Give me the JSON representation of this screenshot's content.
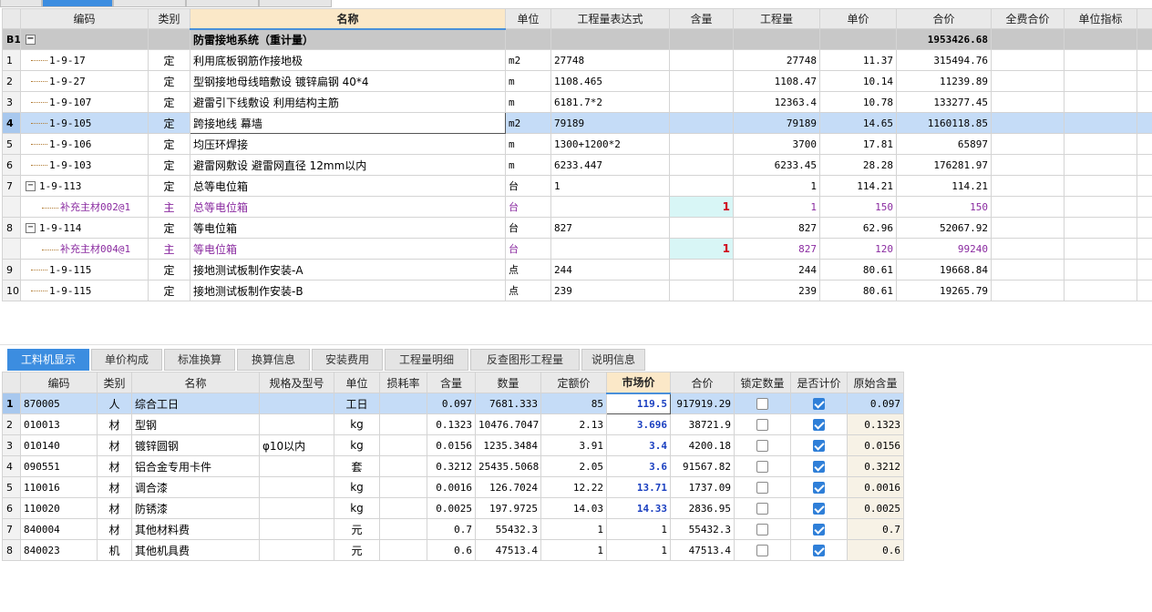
{
  "top_tabs": [
    "",
    "",
    "",
    ""
  ],
  "top_grid": {
    "headers": [
      "",
      "编码",
      "类别",
      "名称",
      "单位",
      "工程量表达式",
      "含量",
      "工程量",
      "单价",
      "合价",
      "全费合价",
      "单位指标"
    ],
    "section": {
      "rn": "B1",
      "expander": "−",
      "name": "防雷接地系统（重计量）",
      "total": "1953426.68"
    },
    "rows": [
      {
        "rn": "1",
        "code": "1-9-17",
        "cat": "定",
        "name": "利用底板钢筋作接地极",
        "unit": "m2",
        "expr": "27748",
        "content": "",
        "qty": "27748",
        "price": "11.37",
        "total": "315494.76",
        "kind": "normal"
      },
      {
        "rn": "2",
        "code": "1-9-27",
        "cat": "定",
        "name": "型钢接地母线暗敷设 镀锌扁钢 40*4",
        "unit": "m",
        "expr": "1108.465",
        "content": "",
        "qty": "1108.47",
        "price": "10.14",
        "total": "11239.89",
        "kind": "normal"
      },
      {
        "rn": "3",
        "code": "1-9-107",
        "cat": "定",
        "name": "避雷引下线敷设 利用结构主筋",
        "unit": "m",
        "expr": "6181.7*2",
        "content": "",
        "qty": "12363.4",
        "price": "10.78",
        "total": "133277.45",
        "kind": "normal"
      },
      {
        "rn": "4",
        "code": "1-9-105",
        "cat": "定",
        "name": "跨接地线 幕墙",
        "unit": "m2",
        "expr": "79189",
        "content": "",
        "qty": "79189",
        "price": "14.65",
        "total": "1160118.85",
        "kind": "selected"
      },
      {
        "rn": "5",
        "code": "1-9-106",
        "cat": "定",
        "name": "均压环焊接",
        "unit": "m",
        "expr": "1300+1200*2",
        "content": "",
        "qty": "3700",
        "price": "17.81",
        "total": "65897",
        "kind": "normal"
      },
      {
        "rn": "6",
        "code": "1-9-103",
        "cat": "定",
        "name": "避雷网敷设 避雷网直径 12mm以内",
        "unit": "m",
        "expr": "6233.447",
        "content": "",
        "qty": "6233.45",
        "price": "28.28",
        "total": "176281.97",
        "kind": "normal"
      },
      {
        "rn": "7",
        "code": "1-9-113",
        "cat": "定",
        "name": "总等电位箱",
        "unit": "台",
        "expr": "1",
        "content": "",
        "qty": "1",
        "price": "114.21",
        "total": "114.21",
        "kind": "parent",
        "expander": "−"
      },
      {
        "rn": "",
        "code": "补充主材002@1",
        "cat": "主",
        "name": "总等电位箱",
        "unit": "台",
        "expr": "",
        "content": "1",
        "qty": "1",
        "price": "150",
        "total": "150",
        "kind": "sub"
      },
      {
        "rn": "8",
        "code": "1-9-114",
        "cat": "定",
        "name": "等电位箱",
        "unit": "台",
        "expr": "827",
        "content": "",
        "qty": "827",
        "price": "62.96",
        "total": "52067.92",
        "kind": "parent",
        "expander": "−"
      },
      {
        "rn": "",
        "code": "补充主材004@1",
        "cat": "主",
        "name": "等电位箱",
        "unit": "台",
        "expr": "",
        "content": "1",
        "qty": "827",
        "price": "120",
        "total": "99240",
        "kind": "sub"
      },
      {
        "rn": "9",
        "code": "1-9-115",
        "cat": "定",
        "name": "接地测试板制作安装-A",
        "unit": "点",
        "expr": "244",
        "content": "",
        "qty": "244",
        "price": "80.61",
        "total": "19668.84",
        "kind": "normal"
      },
      {
        "rn": "10",
        "code": "1-9-115",
        "cat": "定",
        "name": "接地测试板制作安装-B",
        "unit": "点",
        "expr": "239",
        "content": "",
        "qty": "239",
        "price": "80.61",
        "total": "19265.79",
        "kind": "normal"
      }
    ]
  },
  "bottom_tabs": [
    "工料机显示",
    "单价构成",
    "标准换算",
    "换算信息",
    "安装费用",
    "工程量明细",
    "反查图形工程量",
    "说明信息"
  ],
  "bottom_grid": {
    "headers": [
      "",
      "编码",
      "类别",
      "名称",
      "规格及型号",
      "单位",
      "损耗率",
      "含量",
      "数量",
      "定额价",
      "市场价",
      "合价",
      "锁定数量",
      "是否计价",
      "原始含量"
    ],
    "rows": [
      {
        "rn": "1",
        "code": "870005",
        "cat": "人",
        "name": "综合工日",
        "spec": "",
        "unit": "工日",
        "loss": "",
        "content": "0.097",
        "qty": "7681.333",
        "quota": "85",
        "market": "119.5",
        "total": "917919.29",
        "locked": false,
        "priced": true,
        "orig": "0.097",
        "selected": true,
        "market_blue": true
      },
      {
        "rn": "2",
        "code": "010013",
        "cat": "材",
        "name": "型钢",
        "spec": "",
        "unit": "kg",
        "loss": "",
        "content": "0.1323",
        "qty": "10476.7047",
        "quota": "2.13",
        "market": "3.696",
        "total": "38721.9",
        "locked": false,
        "priced": true,
        "orig": "0.1323",
        "selected": false,
        "market_blue": true
      },
      {
        "rn": "3",
        "code": "010140",
        "cat": "材",
        "name": "镀锌圆钢",
        "spec": "φ10以内",
        "unit": "kg",
        "loss": "",
        "content": "0.0156",
        "qty": "1235.3484",
        "quota": "3.91",
        "market": "3.4",
        "total": "4200.18",
        "locked": false,
        "priced": true,
        "orig": "0.0156",
        "selected": false,
        "market_blue": true
      },
      {
        "rn": "4",
        "code": "090551",
        "cat": "材",
        "name": "铝合金专用卡件",
        "spec": "",
        "unit": "套",
        "loss": "",
        "content": "0.3212",
        "qty": "25435.5068",
        "quota": "2.05",
        "market": "3.6",
        "total": "91567.82",
        "locked": false,
        "priced": true,
        "orig": "0.3212",
        "selected": false,
        "market_blue": true
      },
      {
        "rn": "5",
        "code": "110016",
        "cat": "材",
        "name": "调合漆",
        "spec": "",
        "unit": "kg",
        "loss": "",
        "content": "0.0016",
        "qty": "126.7024",
        "quota": "12.22",
        "market": "13.71",
        "total": "1737.09",
        "locked": false,
        "priced": true,
        "orig": "0.0016",
        "selected": false,
        "market_blue": true
      },
      {
        "rn": "6",
        "code": "110020",
        "cat": "材",
        "name": "防锈漆",
        "spec": "",
        "unit": "kg",
        "loss": "",
        "content": "0.0025",
        "qty": "197.9725",
        "quota": "14.03",
        "market": "14.33",
        "total": "2836.95",
        "locked": false,
        "priced": true,
        "orig": "0.0025",
        "selected": false,
        "market_blue": true
      },
      {
        "rn": "7",
        "code": "840004",
        "cat": "材",
        "name": "其他材料费",
        "spec": "",
        "unit": "元",
        "loss": "",
        "content": "0.7",
        "qty": "55432.3",
        "quota": "1",
        "market": "1",
        "total": "55432.3",
        "locked": false,
        "priced": true,
        "orig": "0.7",
        "selected": false,
        "market_blue": false
      },
      {
        "rn": "8",
        "code": "840023",
        "cat": "机",
        "name": "其他机具费",
        "spec": "",
        "unit": "元",
        "loss": "",
        "content": "0.6",
        "qty": "47513.4",
        "quota": "1",
        "market": "1",
        "total": "47513.4",
        "locked": false,
        "priced": true,
        "orig": "0.6",
        "selected": false,
        "market_blue": false
      }
    ]
  },
  "colors": {
    "accent": "#3c8de0",
    "header_hl": "#fbe8c8",
    "section_bg": "#c8c8c8",
    "selected_row": "#c5dcf7",
    "sub_text": "#8a2ba0",
    "price_blue": "#1a3fc0",
    "red": "#d0021b"
  }
}
